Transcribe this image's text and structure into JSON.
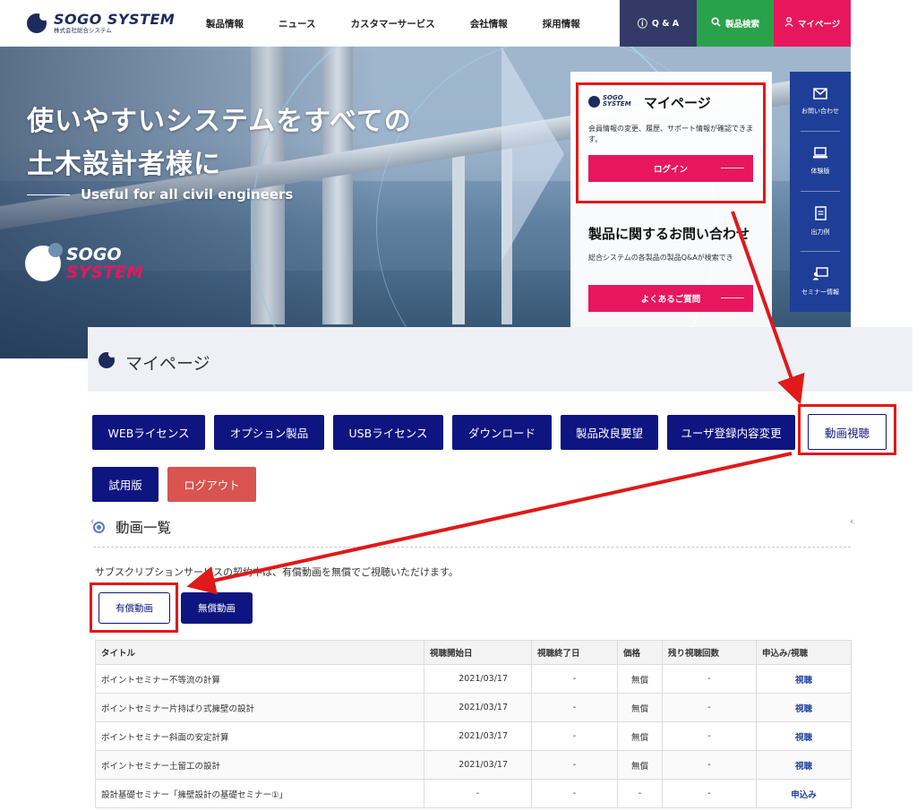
{
  "header": {
    "brand": "SOGO SYSTEM",
    "brand_sub": "株式会社総合システム",
    "nav": [
      "製品情報",
      "ニュース",
      "カスタマーサービス",
      "会社情報",
      "採用情報"
    ],
    "qa_label": "Q & A",
    "search_label": "製品検索",
    "mypage_label": "マイページ",
    "colors": {
      "qa": "#343a66",
      "search": "#2aa14b",
      "mypage": "#e8175d"
    }
  },
  "hero": {
    "title_line1": "使いやすいシステムをすべての",
    "title_line2": "土木設計者様に",
    "subtitle": "Useful for all civil engineers",
    "logo_w1": "SOGO",
    "logo_w2": "SYSTEM"
  },
  "mypage_card": {
    "logo_w1": "SOGO",
    "logo_w2": "SYSTEM",
    "title": "マイページ",
    "desc": "会員情報の変更、履歴、サポート情報が確認できます。",
    "login_label": "ログイン",
    "inquiry_title": "製品に関するお問い合わせ",
    "inquiry_desc": "総合システムの各製品の製品Q&Aが検索でき",
    "faq_label": "よくあるご質問"
  },
  "sidebar": {
    "items": [
      {
        "icon": "mail-icon",
        "label": "お問い合わせ"
      },
      {
        "icon": "laptop-icon",
        "label": "体験版"
      },
      {
        "icon": "document-icon",
        "label": "出力例"
      },
      {
        "icon": "seminar-icon",
        "label": "セミナー情報"
      }
    ]
  },
  "panel": {
    "title": "マイページ",
    "buttons": [
      "WEBライセンス",
      "オプション製品",
      "USBライセンス",
      "ダウンロード",
      "製品改良要望",
      "ユーザ登録内容変更",
      "動画視聴"
    ],
    "buttons_row2": [
      "試用版",
      "ログアウト"
    ]
  },
  "videos": {
    "section_title": "動画一覧",
    "desc": "サブスクリプションサービスの契約中は、有償動画を無償でご視聴いただけます。",
    "tabs": [
      "有償動画",
      "無償動画"
    ],
    "columns": [
      "タイトル",
      "視聴開始日",
      "視聴終了日",
      "価格",
      "残り視聴回数",
      "申込み/視聴"
    ],
    "rows": [
      [
        "ポイントセミナー不等流の計算",
        "2021/03/17",
        "-",
        "無償",
        "-",
        "視聴"
      ],
      [
        "ポイントセミナー片持ばり式擁壁の設計",
        "2021/03/17",
        "-",
        "無償",
        "-",
        "視聴"
      ],
      [
        "ポイントセミナー斜面の安定計算",
        "2021/03/17",
        "-",
        "無償",
        "-",
        "視聴"
      ],
      [
        "ポイントセミナー土留工の設計",
        "2021/03/17",
        "-",
        "無償",
        "-",
        "視聴"
      ],
      [
        "設計基礎セミナー「擁壁設計の基礎セミナー①」",
        "-",
        "-",
        "-",
        "-",
        "申込み"
      ]
    ]
  },
  "annotation_color": "#e01919"
}
